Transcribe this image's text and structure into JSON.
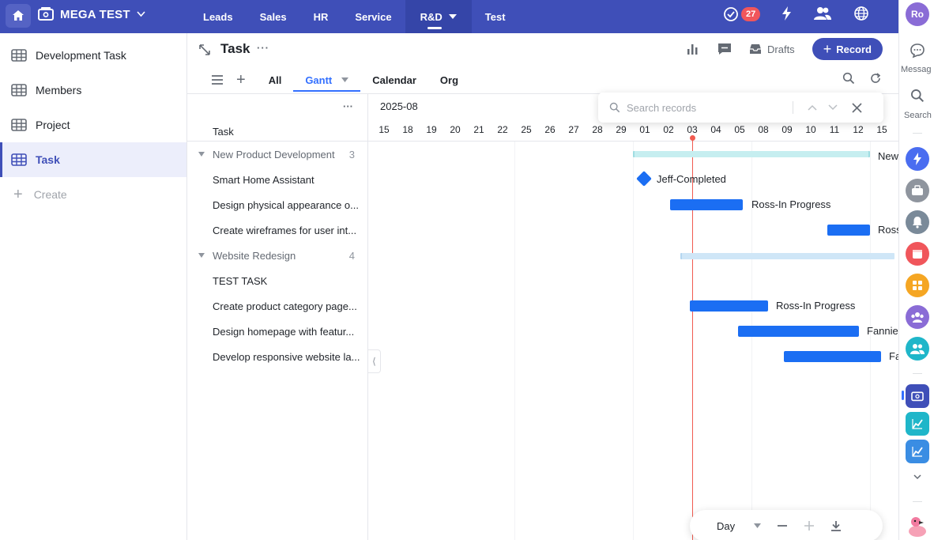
{
  "topbar": {
    "app_title": "MEGA TEST",
    "nav": [
      "Leads",
      "Sales",
      "HR",
      "Service",
      "R&D",
      "Test"
    ],
    "active_nav": "R&D",
    "notification_count": "27",
    "user_initials": "Ro",
    "colors": {
      "bar": "#3f4fb8",
      "active": "#3545a8"
    }
  },
  "sidebar": {
    "items": [
      {
        "label": "Development Task",
        "icon": "table-icon"
      },
      {
        "label": "Members",
        "icon": "table-icon"
      },
      {
        "label": "Project",
        "icon": "table-icon"
      },
      {
        "label": "Task",
        "icon": "table-icon",
        "active": true
      }
    ],
    "create_label": "Create"
  },
  "header": {
    "title": "Task",
    "drafts_label": "Drafts",
    "record_label": "Record",
    "tabs": [
      "All",
      "Gantt",
      "Calendar",
      "Org"
    ],
    "active_tab": "Gantt"
  },
  "tasklist": {
    "column_header": "Task",
    "rows": [
      {
        "type": "group",
        "label": "New Product Development",
        "count": "3"
      },
      {
        "type": "task",
        "label": "Smart Home Assistant"
      },
      {
        "type": "task",
        "label": "Design physical appearance o..."
      },
      {
        "type": "task",
        "label": "Create wireframes for user int..."
      },
      {
        "type": "group",
        "label": "Website Redesign",
        "count": "4"
      },
      {
        "type": "task",
        "label": "TEST TASK"
      },
      {
        "type": "task",
        "label": "Create product category page..."
      },
      {
        "type": "task",
        "label": "Design homepage with featur..."
      },
      {
        "type": "task",
        "label": "Develop responsive website la..."
      }
    ]
  },
  "gantt": {
    "month": "2025-08",
    "days": [
      "15",
      "18",
      "19",
      "20",
      "21",
      "22",
      "25",
      "26",
      "27",
      "28",
      "29",
      "01",
      "02",
      "03",
      "04",
      "05",
      "08",
      "09",
      "10",
      "11",
      "12",
      "15"
    ],
    "today": "03",
    "bar_labels": [
      "New",
      "Jeff-Completed",
      "Ross-In Progress",
      "Ross",
      "Ross-In Progress",
      "Fannie-",
      "Fa"
    ],
    "colors": {
      "bar": "#1b6ef3",
      "group_bar_1": "#c6eef0",
      "group_bar_2": "#cfe6f7",
      "today": "#f15b50"
    }
  },
  "search": {
    "placeholder": "Search records"
  },
  "zoom": {
    "scale": "Day"
  },
  "rail": {
    "message_label": "Messag",
    "search_label": "Search"
  }
}
